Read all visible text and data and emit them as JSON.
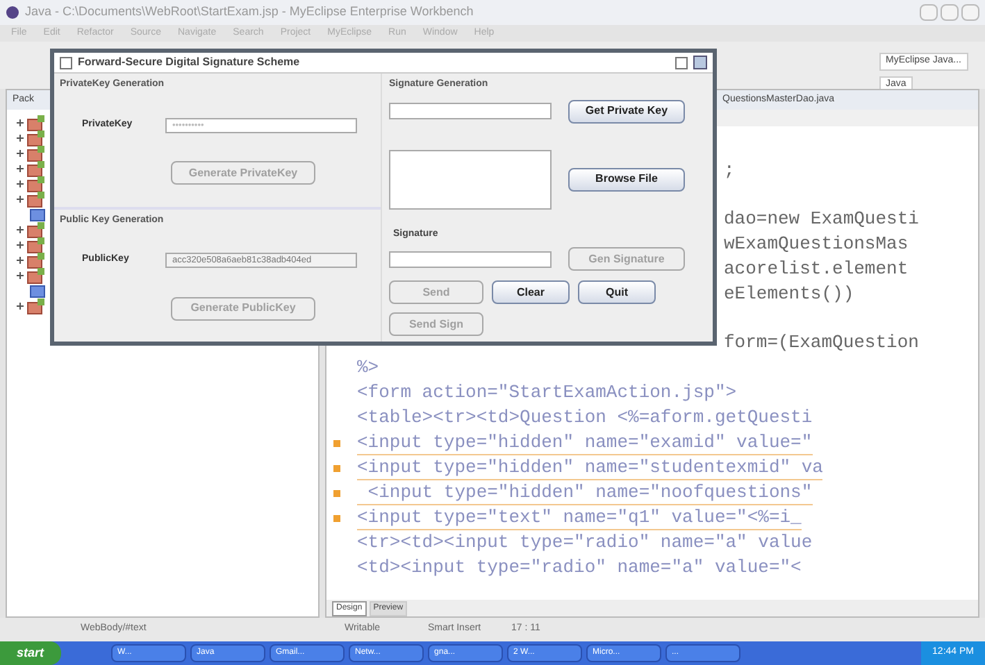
{
  "window": {
    "title": "Java - C:\\Documents\\WebRoot\\StartExam.jsp - MyEclipse Enterprise Workbench"
  },
  "menu": [
    "File",
    "Edit",
    "Refactor",
    "Source",
    "Navigate",
    "Search",
    "Project",
    "MyEclipse",
    "Run",
    "Window",
    "Help"
  ],
  "perspectives": [
    "MyEclipse Java...",
    "Java"
  ],
  "explorer": {
    "tab": "Pack",
    "nodes": [
      {
        "kind": "project",
        "expanded": false
      },
      {
        "kind": "project",
        "expanded": false
      },
      {
        "kind": "project",
        "expanded": false
      },
      {
        "kind": "project",
        "expanded": false
      },
      {
        "kind": "project",
        "expanded": false
      },
      {
        "kind": "project",
        "expanded": false
      },
      {
        "kind": "file"
      },
      {
        "kind": "project",
        "expanded": false
      },
      {
        "kind": "project",
        "expanded": false
      },
      {
        "kind": "project",
        "expanded": false
      },
      {
        "kind": "project",
        "expanded": false
      },
      {
        "kind": "file"
      },
      {
        "kind": "project",
        "expanded": false
      }
    ]
  },
  "editor": {
    "tab": "QuestionsMasterDao.java",
    "lines": [
      {
        "kind": "tail",
        "text": ";",
        "warning": false
      },
      {
        "kind": "tail",
        "text": "dao=new ExamQuesti",
        "warning": false
      },
      {
        "kind": "tail",
        "text": "wExamQuestionsMas",
        "warning": false
      },
      {
        "kind": "tail",
        "text": "acorelist.element",
        "warning": false
      },
      {
        "kind": "tail",
        "text": "eElements())",
        "warning": false
      },
      {
        "kind": "tail",
        "text": "form=(ExamQuestion",
        "warning": false
      },
      {
        "kind": "full",
        "text": "%>",
        "warning": false
      },
      {
        "kind": "full",
        "text": "<form action=\"StartExamAction.jsp\">",
        "warning": false
      },
      {
        "kind": "full",
        "text": "<table><tr><td>Question <%=aform.getQuesti",
        "warning": false
      },
      {
        "kind": "full",
        "text": "<input type=\"hidden\" name=\"examid\" value=\"",
        "warning": true
      },
      {
        "kind": "full",
        "text": "<input type=\"hidden\" name=\"studentexmid\" va",
        "warning": true
      },
      {
        "kind": "full",
        "text": " <input type=\"hidden\" name=\"noofquestions\"",
        "warning": true
      },
      {
        "kind": "full",
        "text": "<input type=\"text\" name=\"q1\" value=\"<%=i_",
        "warning": true
      },
      {
        "kind": "full",
        "text": "<tr><td><input type=\"radio\" name=\"a\" value",
        "warning": false
      },
      {
        "kind": "full",
        "text": "<td><input type=\"radio\" name=\"a\" value=\"<",
        "warning": false
      }
    ],
    "view_tabs": [
      {
        "label": "Design",
        "selected": true
      },
      {
        "label": "Preview",
        "selected": false
      }
    ]
  },
  "dialog": {
    "title": "Forward-Secure Digital Signature Scheme",
    "private_section": {
      "heading": "PrivateKey Generation",
      "label": "PrivateKey",
      "value": "••••••••••",
      "button": {
        "label": "Generate PrivateKey",
        "disabled": true
      }
    },
    "public_section": {
      "heading": "Public Key Generation",
      "label": "PublicKey",
      "value": "acc320e508a6aeb81c38adb404ed",
      "button": {
        "label": "Generate PublicKey",
        "disabled": true
      }
    },
    "signature_section": {
      "heading": "Signature Generation",
      "get_key": {
        "label": "Get Private Key",
        "disabled": false
      },
      "browse": {
        "label": "Browse File",
        "disabled": false
      },
      "signature_label": "Signature",
      "gen": {
        "label": "Gen Signature",
        "disabled": true
      }
    },
    "buttons": [
      {
        "label": "Send",
        "disabled": true
      },
      {
        "label": "Clear",
        "disabled": false
      },
      {
        "label": "Quit",
        "disabled": false
      },
      {
        "label": "Send Sign",
        "disabled": true
      }
    ]
  },
  "status_bar": {
    "path": "WebBody/#text",
    "mode": "Writable",
    "insert": "Smart Insert",
    "position": "17 : 11"
  },
  "taskbar": {
    "start": "start",
    "items": [
      "W...",
      "Java",
      "Gmail...",
      "Netw...",
      "gna...",
      "2 W...",
      "Micro...",
      "..."
    ],
    "clock": "12:44 PM"
  }
}
